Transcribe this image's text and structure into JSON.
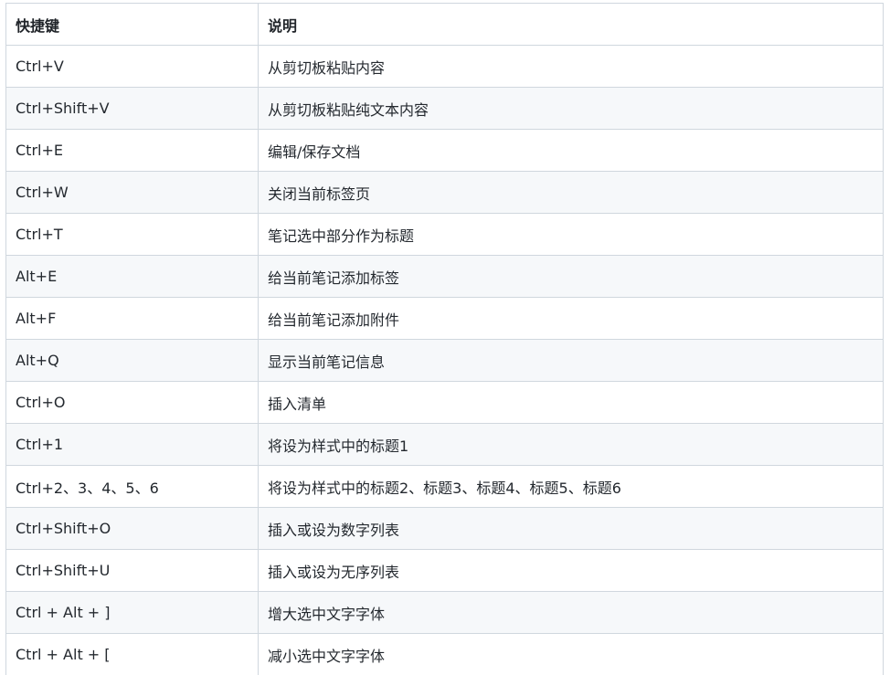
{
  "table": {
    "headers": [
      "快捷键",
      "说明"
    ],
    "rows": [
      {
        "key": "Ctrl+V",
        "desc": "从剪切板粘贴内容"
      },
      {
        "key": "Ctrl+Shift+V",
        "desc": "从剪切板粘贴纯文本内容"
      },
      {
        "key": "Ctrl+E",
        "desc": "编辑/保存文档"
      },
      {
        "key": "Ctrl+W",
        "desc": "关闭当前标签页"
      },
      {
        "key": "Ctrl+T",
        "desc": "笔记选中部分作为标题"
      },
      {
        "key": "Alt+E",
        "desc": "给当前笔记添加标签"
      },
      {
        "key": "Alt+F",
        "desc": "给当前笔记添加附件"
      },
      {
        "key": "Alt+Q",
        "desc": "显示当前笔记信息"
      },
      {
        "key": "Ctrl+O",
        "desc": "插入清单"
      },
      {
        "key": "Ctrl+1",
        "desc": "将设为样式中的标题1"
      },
      {
        "key": "Ctrl+2、3、4、5、6",
        "desc": "将设为样式中的标题2、标题3、标题4、标题5、标题6"
      },
      {
        "key": "Ctrl+Shift+O",
        "desc": "插入或设为数字列表"
      },
      {
        "key": "Ctrl+Shift+U",
        "desc": "插入或设为无序列表"
      },
      {
        "key": "Ctrl + Alt + ]",
        "desc": "增大选中文字字体"
      },
      {
        "key": "Ctrl + Alt + [",
        "desc": "减小选中文字字体"
      }
    ]
  }
}
